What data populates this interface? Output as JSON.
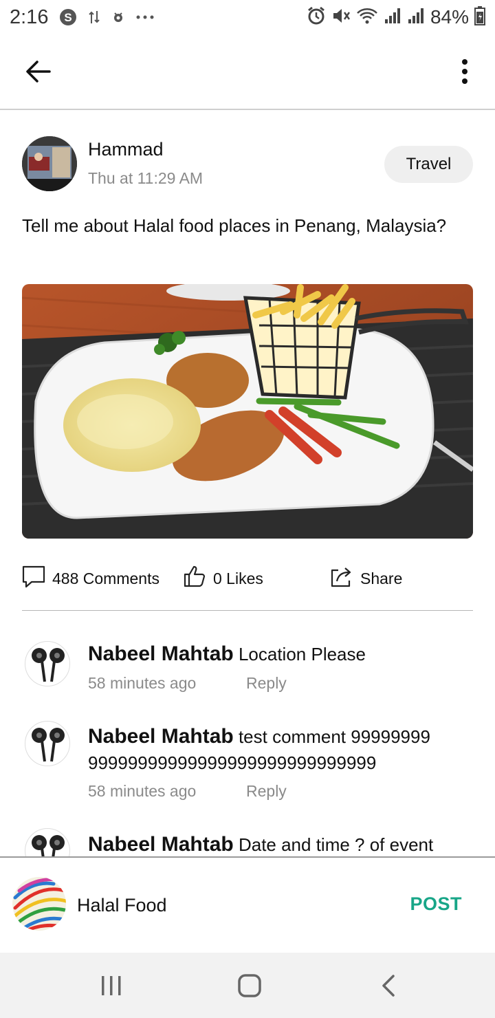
{
  "status_bar": {
    "time": "2:16",
    "battery": "84%",
    "icons": [
      "skype-icon",
      "data-transfer-icon",
      "notification-icon",
      "more-dots-icon",
      "alarm-icon",
      "mute-icon",
      "wifi-icon",
      "signal-icon",
      "signal-icon",
      "battery-icon"
    ]
  },
  "app_bar": {
    "back_icon": "arrow-left-icon",
    "menu_icon": "more-vertical-icon"
  },
  "post": {
    "author": "Hammad",
    "timestamp": "Thu at 11:29 AM",
    "category": "Travel",
    "text": "Tell me about Halal food places in Penang, Malaysia?",
    "image": "photo of a plate with breaded cutlet, cream sauce, fries basket and vegetables"
  },
  "actions": {
    "comments": "488 Comments",
    "likes": "0 Likes",
    "share": "Share"
  },
  "comments": [
    {
      "name": "Nabeel Mahtab",
      "text": "Location Please",
      "time": "58 minutes ago",
      "reply": "Reply"
    },
    {
      "name": "Nabeel Mahtab",
      "text": "test comment 99999999 99999999999999999999999999999",
      "time": "58 minutes ago",
      "reply": "Reply"
    },
    {
      "name": "Nabeel Mahtab",
      "text": "Date and time ? of event",
      "time": "",
      "reply": ""
    }
  ],
  "composer": {
    "group": "Halal Food",
    "post_label": "POST",
    "accent": "#18a688"
  },
  "nav_bar": {
    "icons": [
      "recent-apps-icon",
      "home-icon",
      "back-icon"
    ]
  }
}
